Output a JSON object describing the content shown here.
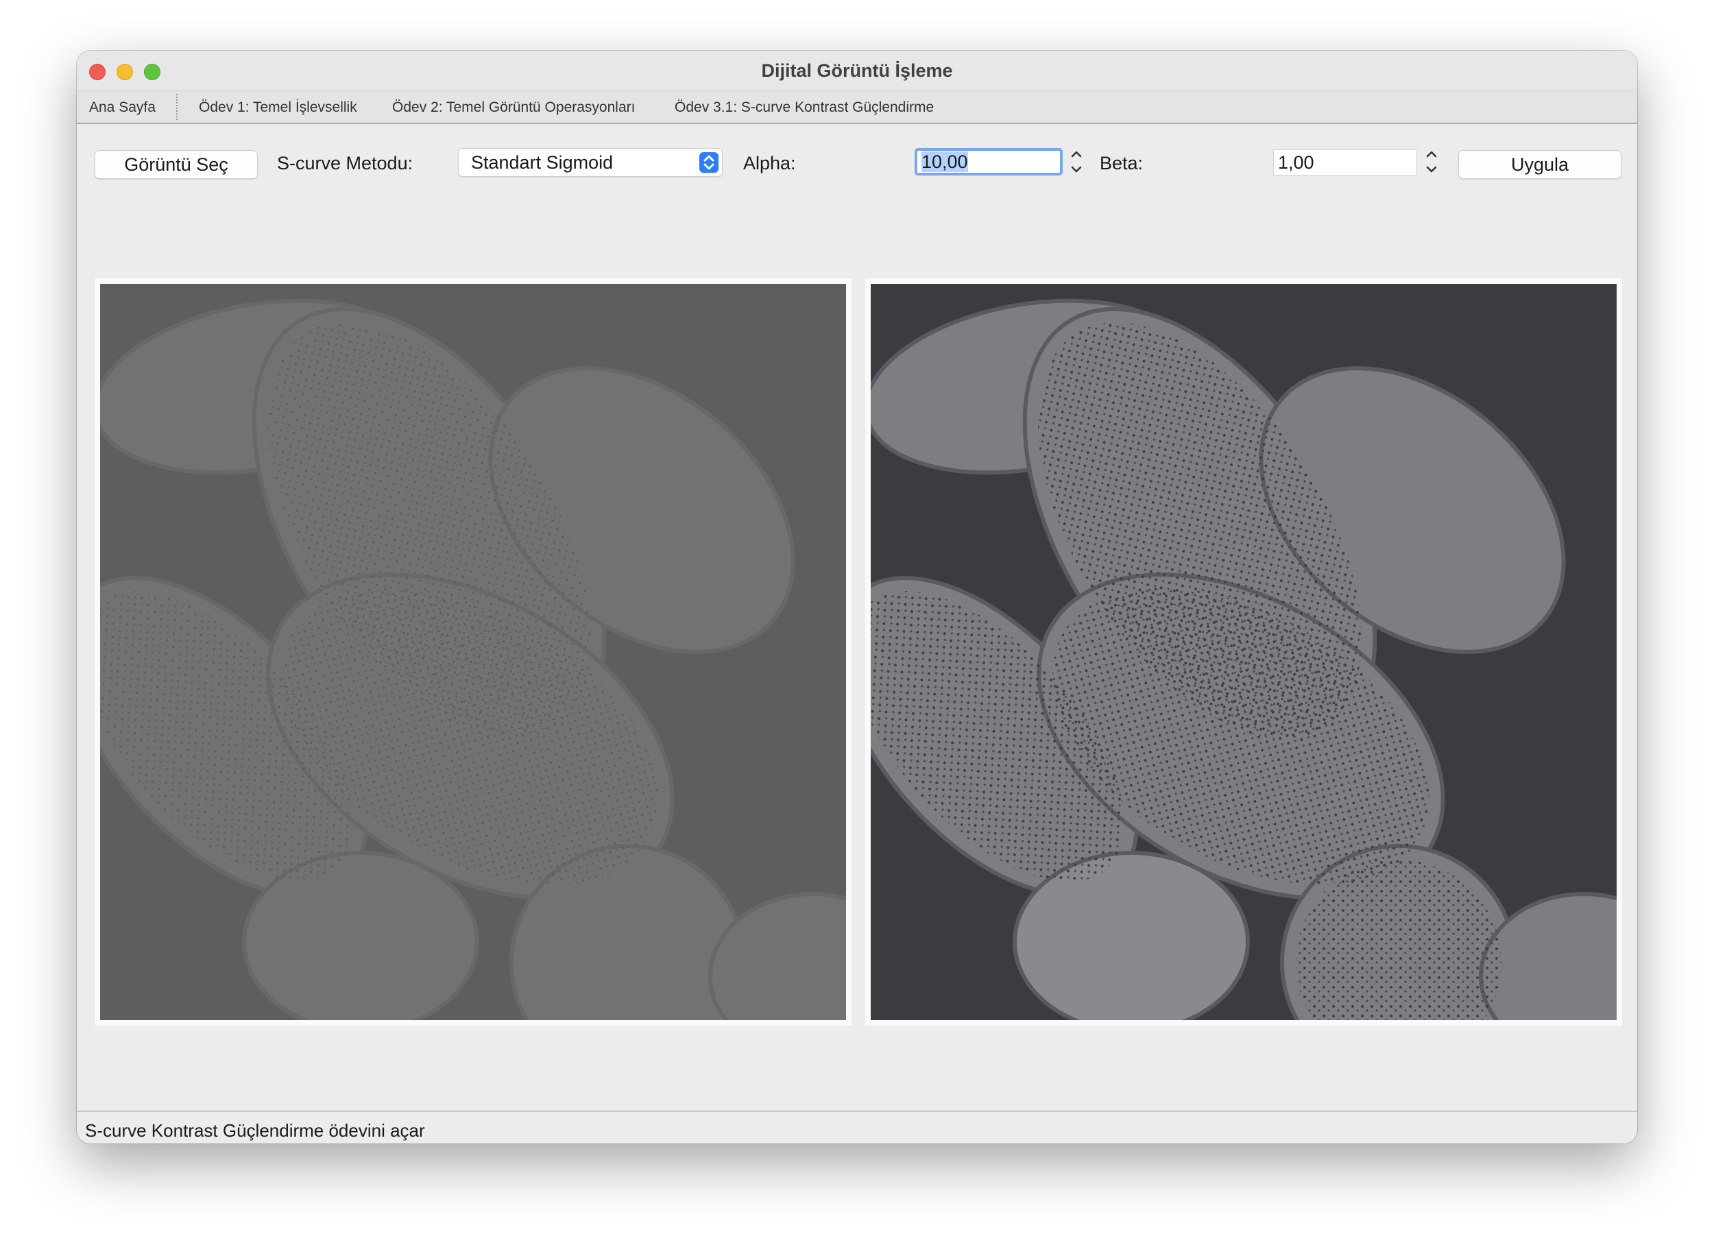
{
  "window": {
    "title": "Dijital Görüntü İşleme"
  },
  "menu": {
    "items": [
      "Ana Sayfa",
      "Ödev 1: Temel İşlevsellik",
      "Ödev 2: Temel Görüntü Operasyonları",
      "Ödev 3.1: S-curve Kontrast Güçlendirme"
    ]
  },
  "toolbar": {
    "select_image_label": "Görüntü Seç",
    "method_label": "S-curve Metodu:",
    "method_value": "Standart Sigmoid",
    "alpha_label": "Alpha:",
    "alpha_value": "10,00",
    "beta_label": "Beta:",
    "beta_value": "1,00",
    "apply_label": "Uygula"
  },
  "colors": {
    "accent": "#2e7cf6",
    "focus_ring": "#7aa6ec",
    "original_bg": "#5d5d5d",
    "processed_bg": "#3b3c40"
  },
  "icons": {
    "close": "close-traffic-light-icon",
    "minimize": "minimize-traffic-light-icon",
    "zoom": "zoom-traffic-light-icon",
    "select_arrows": "up-down-chevron-icon",
    "stepper": "stepper-icon"
  },
  "status": {
    "text": "S-curve Kontrast Güçlendirme ödevini açar"
  }
}
